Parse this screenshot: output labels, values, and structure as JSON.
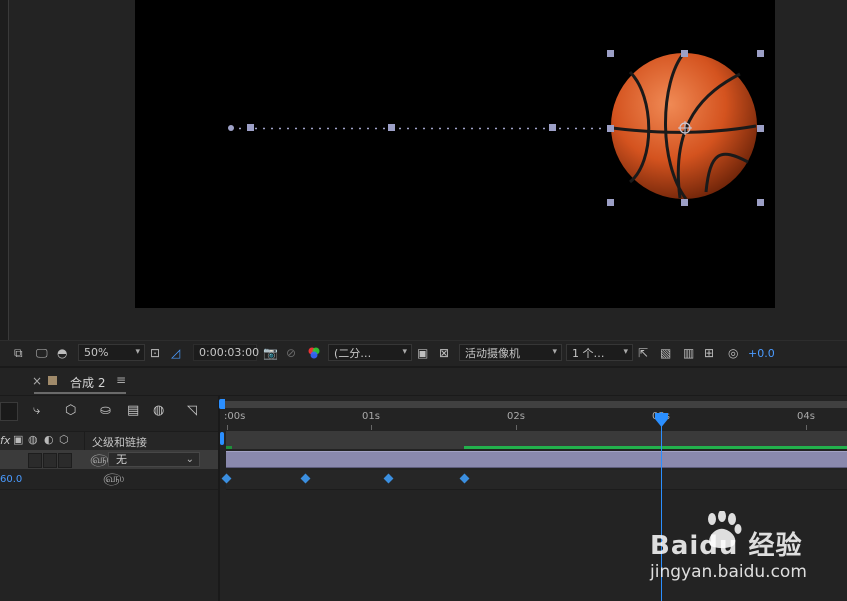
{
  "viewer": {
    "toolbar": {
      "zoom": "50%",
      "timecode": "0:00:03:00",
      "resolution": "(二分…",
      "camera": "活动摄像机",
      "views": "1 个…",
      "exposure": "+0.0"
    }
  },
  "timeline": {
    "tab": {
      "close": "×",
      "label": "合成 2",
      "menu": "≡"
    },
    "header": {
      "fx_label": "fx",
      "parent_column": "父级和链接"
    },
    "layer": {
      "parent_value": "无"
    },
    "property": {
      "value": "60.0"
    },
    "ruler": {
      "ticks": [
        ":00s",
        "01s",
        "02s",
        "03s",
        "04s"
      ]
    }
  },
  "watermark": {
    "brand": "Baidu 经验",
    "url": "jingyan.baidu.com"
  },
  "colors": {
    "accent_blue": "#2b8fff",
    "layer_bar": "#8a89ad",
    "keyframe": "#3b8fe0",
    "work_area_green": "#22b14c"
  }
}
